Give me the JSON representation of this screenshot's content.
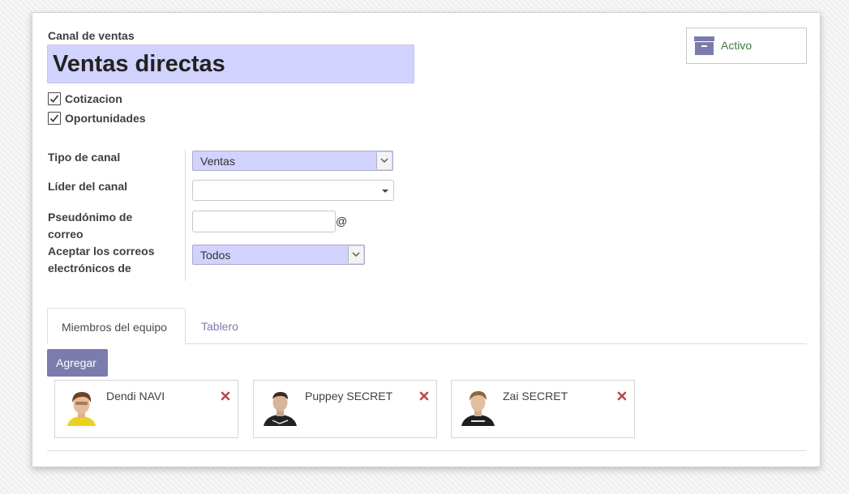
{
  "form": {
    "channel_label": "Canal de ventas",
    "channel_name": "Ventas directas",
    "active_button": "Activo",
    "options": [
      {
        "label": "Cotizacion",
        "checked": true
      },
      {
        "label": "Oportunidades",
        "checked": true
      }
    ],
    "fields": {
      "tipo_label": "Tipo de canal",
      "tipo_value": "Ventas",
      "lider_label": "Líder del canal",
      "lider_value": "",
      "alias_label_1": "Pseudónimo de",
      "alias_label_2": "correo",
      "alias_value": "",
      "alias_suffix": "@",
      "accept_label_1": "Aceptar los correos",
      "accept_label_2": "electrónicos de",
      "accept_value": "Todos"
    }
  },
  "tabs": {
    "members": "Miembros del equipo",
    "dashboard": "Tablero"
  },
  "add_button": "Agregar",
  "members": [
    {
      "name": "Dendi NAVI",
      "avatar_icon": "avatar-photo-icon"
    },
    {
      "name": "Puppey SECRET",
      "avatar_icon": "avatar-photo-icon"
    },
    {
      "name": "Zai SECRET",
      "avatar_icon": "avatar-photo-icon"
    }
  ],
  "colors": {
    "primary": "#7c7bad",
    "highlight_input": "#d2d2ff",
    "active_text": "#3f7a3f",
    "delete": "#b94a48"
  }
}
